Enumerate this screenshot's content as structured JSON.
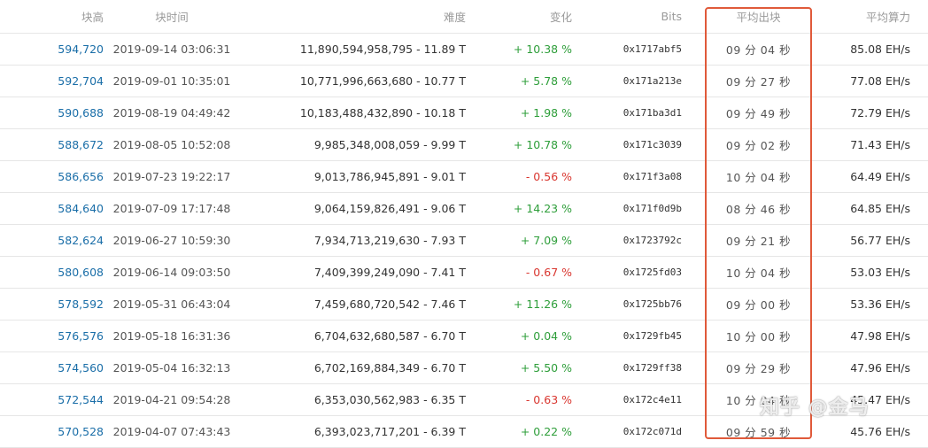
{
  "header": {
    "height": "块高",
    "time": "块时间",
    "difficulty": "难度",
    "change": "变化",
    "bits": "Bits",
    "avg_time": "平均出块",
    "avg_hashrate": "平均算力"
  },
  "colors": {
    "link": "#1a6ea8",
    "positive": "#2e9e3a",
    "negative": "#d9362f",
    "highlight": "#e05a3a"
  },
  "rows": [
    {
      "height": "594,720",
      "time": "2019-09-14 03:06:31",
      "difficulty": "11,890,594,958,795 - 11.89 T",
      "change": "+ 10.38 %",
      "change_sign": "pos",
      "bits": "0x1717abf5",
      "avg_time": "09 分 04 秒",
      "hashrate": "85.08 EH/s"
    },
    {
      "height": "592,704",
      "time": "2019-09-01 10:35:01",
      "difficulty": "10,771,996,663,680 - 10.77 T",
      "change": "+ 5.78 %",
      "change_sign": "pos",
      "bits": "0x171a213e",
      "avg_time": "09 分 27 秒",
      "hashrate": "77.08 EH/s"
    },
    {
      "height": "590,688",
      "time": "2019-08-19 04:49:42",
      "difficulty": "10,183,488,432,890 - 10.18 T",
      "change": "+ 1.98 %",
      "change_sign": "pos",
      "bits": "0x171ba3d1",
      "avg_time": "09 分 49 秒",
      "hashrate": "72.79 EH/s"
    },
    {
      "height": "588,672",
      "time": "2019-08-05 10:52:08",
      "difficulty": "9,985,348,008,059 - 9.99 T",
      "change": "+ 10.78 %",
      "change_sign": "pos",
      "bits": "0x171c3039",
      "avg_time": "09 分 02 秒",
      "hashrate": "71.43 EH/s"
    },
    {
      "height": "586,656",
      "time": "2019-07-23 19:22:17",
      "difficulty": "9,013,786,945,891 - 9.01 T",
      "change": "- 0.56 %",
      "change_sign": "neg",
      "bits": "0x171f3a08",
      "avg_time": "10 分 04 秒",
      "hashrate": "64.49 EH/s"
    },
    {
      "height": "584,640",
      "time": "2019-07-09 17:17:48",
      "difficulty": "9,064,159,826,491 - 9.06 T",
      "change": "+ 14.23 %",
      "change_sign": "pos",
      "bits": "0x171f0d9b",
      "avg_time": "08 分 46 秒",
      "hashrate": "64.85 EH/s"
    },
    {
      "height": "582,624",
      "time": "2019-06-27 10:59:30",
      "difficulty": "7,934,713,219,630 - 7.93 T",
      "change": "+ 7.09 %",
      "change_sign": "pos",
      "bits": "0x1723792c",
      "avg_time": "09 分 21 秒",
      "hashrate": "56.77 EH/s"
    },
    {
      "height": "580,608",
      "time": "2019-06-14 09:03:50",
      "difficulty": "7,409,399,249,090 - 7.41 T",
      "change": "- 0.67 %",
      "change_sign": "neg",
      "bits": "0x1725fd03",
      "avg_time": "10 分 04 秒",
      "hashrate": "53.03 EH/s"
    },
    {
      "height": "578,592",
      "time": "2019-05-31 06:43:04",
      "difficulty": "7,459,680,720,542 - 7.46 T",
      "change": "+ 11.26 %",
      "change_sign": "pos",
      "bits": "0x1725bb76",
      "avg_time": "09 分 00 秒",
      "hashrate": "53.36 EH/s"
    },
    {
      "height": "576,576",
      "time": "2019-05-18 16:31:36",
      "difficulty": "6,704,632,680,587 - 6.70 T",
      "change": "+ 0.04 %",
      "change_sign": "pos",
      "bits": "0x1729fb45",
      "avg_time": "10 分 00 秒",
      "hashrate": "47.98 EH/s"
    },
    {
      "height": "574,560",
      "time": "2019-05-04 16:32:13",
      "difficulty": "6,702,169,884,349 - 6.70 T",
      "change": "+ 5.50 %",
      "change_sign": "pos",
      "bits": "0x1729ff38",
      "avg_time": "09 分 29 秒",
      "hashrate": "47.96 EH/s"
    },
    {
      "height": "572,544",
      "time": "2019-04-21 09:54:28",
      "difficulty": "6,353,030,562,983 - 6.35 T",
      "change": "- 0.63 %",
      "change_sign": "neg",
      "bits": "0x172c4e11",
      "avg_time": "10 分 04 秒",
      "hashrate": "45.47 EH/s"
    },
    {
      "height": "570,528",
      "time": "2019-04-07 07:43:43",
      "difficulty": "6,393,023,717,201 - 6.39 T",
      "change": "+ 0.22 %",
      "change_sign": "pos",
      "bits": "0x172c071d",
      "avg_time": "09 分 59 秒",
      "hashrate": "45.76 EH/s"
    }
  ],
  "watermark": "知乎 @金马"
}
